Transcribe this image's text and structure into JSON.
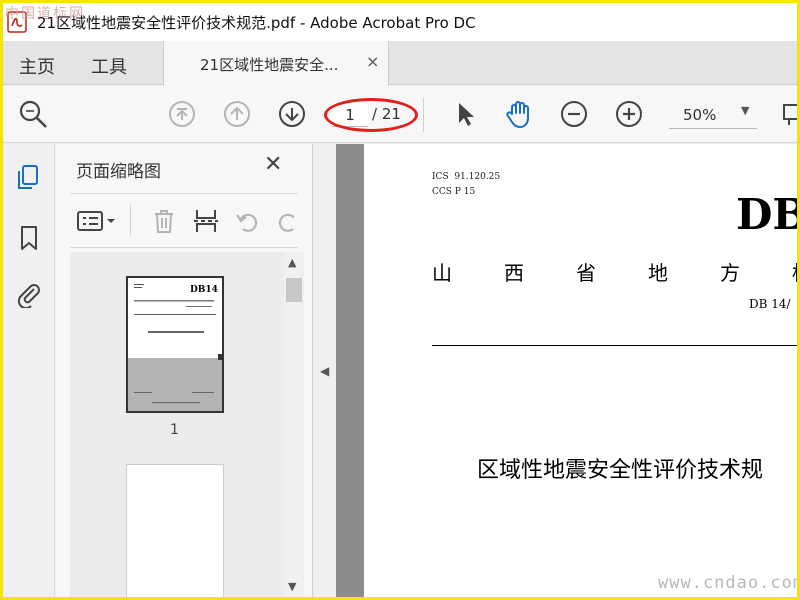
{
  "window": {
    "title": "21区域性地震安全性评价技术规范.pdf - Adobe Acrobat Pro DC",
    "watermark_top": "中国道标网"
  },
  "nav": {
    "home": "主页",
    "tools": "工具",
    "doc_tab": "21区域性地震安全...",
    "doc_tab_close": "×"
  },
  "toolbar": {
    "current_page": "1",
    "total_pages": "/ 21",
    "zoom": "50%",
    "zoom_caret": "▼"
  },
  "thumbnails": {
    "panel_title": "页面缩略图",
    "close": "✕",
    "page_label": "1"
  },
  "document": {
    "ics": "ICS  91.120.25",
    "ccs": "CCS P 15",
    "db_code": "DB",
    "province": "山西省地方标",
    "db_number": "DB 14/",
    "title": "区域性地震安全性评价技术规"
  },
  "watermark_bottom": "www.cndao.com",
  "colors": {
    "frame": "#f5e400",
    "annotation": "#e0201a",
    "hand_tool": "#1a6fc4",
    "sidebar_active": "#1a6fc4"
  }
}
